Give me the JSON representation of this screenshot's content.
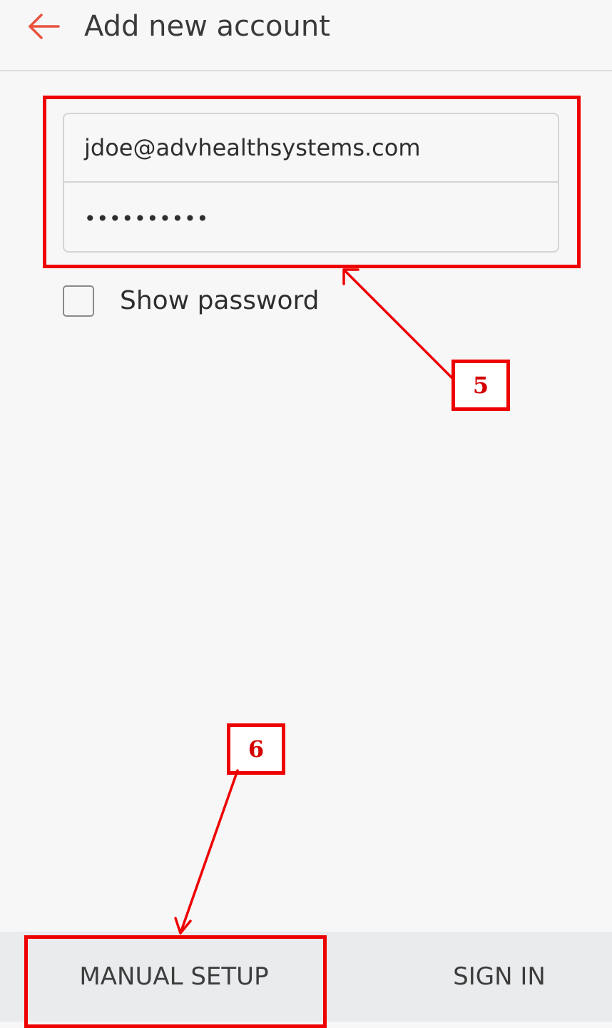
{
  "header": {
    "back_icon": "arrow-left-icon",
    "title": "Add new account"
  },
  "form": {
    "email_value": "jdoe@advhealthsystems.com",
    "password_value": "••••••••••",
    "show_password_label": "Show password",
    "show_password_checked": false
  },
  "annotations": {
    "callout_5": "5",
    "callout_6": "6",
    "highlight_color": "#ee0000"
  },
  "footer": {
    "manual_setup_label": "MANUAL SETUP",
    "sign_in_label": "SIGN IN"
  },
  "colors": {
    "accent": "#e8533f",
    "background": "#f7f7f7",
    "footer_background": "#e9ebed"
  }
}
